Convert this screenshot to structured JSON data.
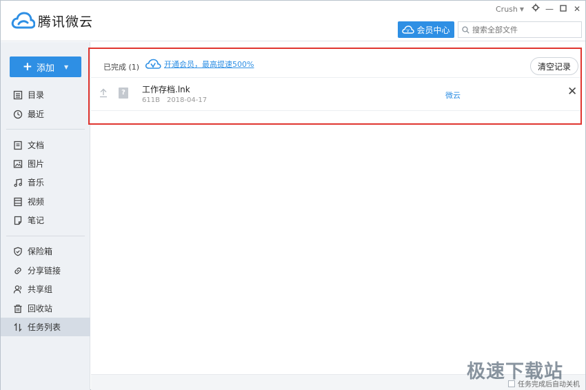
{
  "app": {
    "title": "腾讯微云",
    "brand_color": "#2e8fe4"
  },
  "titlebar": {
    "username": "Crush",
    "window_buttons": [
      "gear-icon",
      "minimize-icon",
      "maximize-icon",
      "close-icon"
    ],
    "vip_label": "会员中心",
    "search_placeholder": "搜索全部文件"
  },
  "sidebar": {
    "add_label": "添加",
    "groups": [
      [
        {
          "label": "目录",
          "icon": "list-icon"
        },
        {
          "label": "最近",
          "icon": "clock-icon"
        }
      ],
      [
        {
          "label": "文档",
          "icon": "document-icon"
        },
        {
          "label": "图片",
          "icon": "image-icon"
        },
        {
          "label": "音乐",
          "icon": "music-icon"
        },
        {
          "label": "视频",
          "icon": "video-icon"
        },
        {
          "label": "笔记",
          "icon": "note-icon"
        }
      ],
      [
        {
          "label": "保险箱",
          "icon": "shield-icon"
        },
        {
          "label": "分享链接",
          "icon": "link-icon"
        },
        {
          "label": "共享组",
          "icon": "group-icon"
        },
        {
          "label": "回收站",
          "icon": "trash-icon"
        },
        {
          "label": "任务列表",
          "icon": "transfer-icon",
          "active": true
        }
      ]
    ]
  },
  "main": {
    "done_label": "已完成 (1)",
    "promo_text": "开通会员，最高提速500%",
    "clear_label": "清空记录",
    "tasks": [
      {
        "name": "工作存档.lnk",
        "size": "611B",
        "date": "2018-04-17",
        "destination": "微云",
        "file_icon_glyph": "?"
      }
    ],
    "footer_check_label": "任务完成后自动关机"
  },
  "watermark": "极速下载站",
  "highlight_color": "#e0352f"
}
